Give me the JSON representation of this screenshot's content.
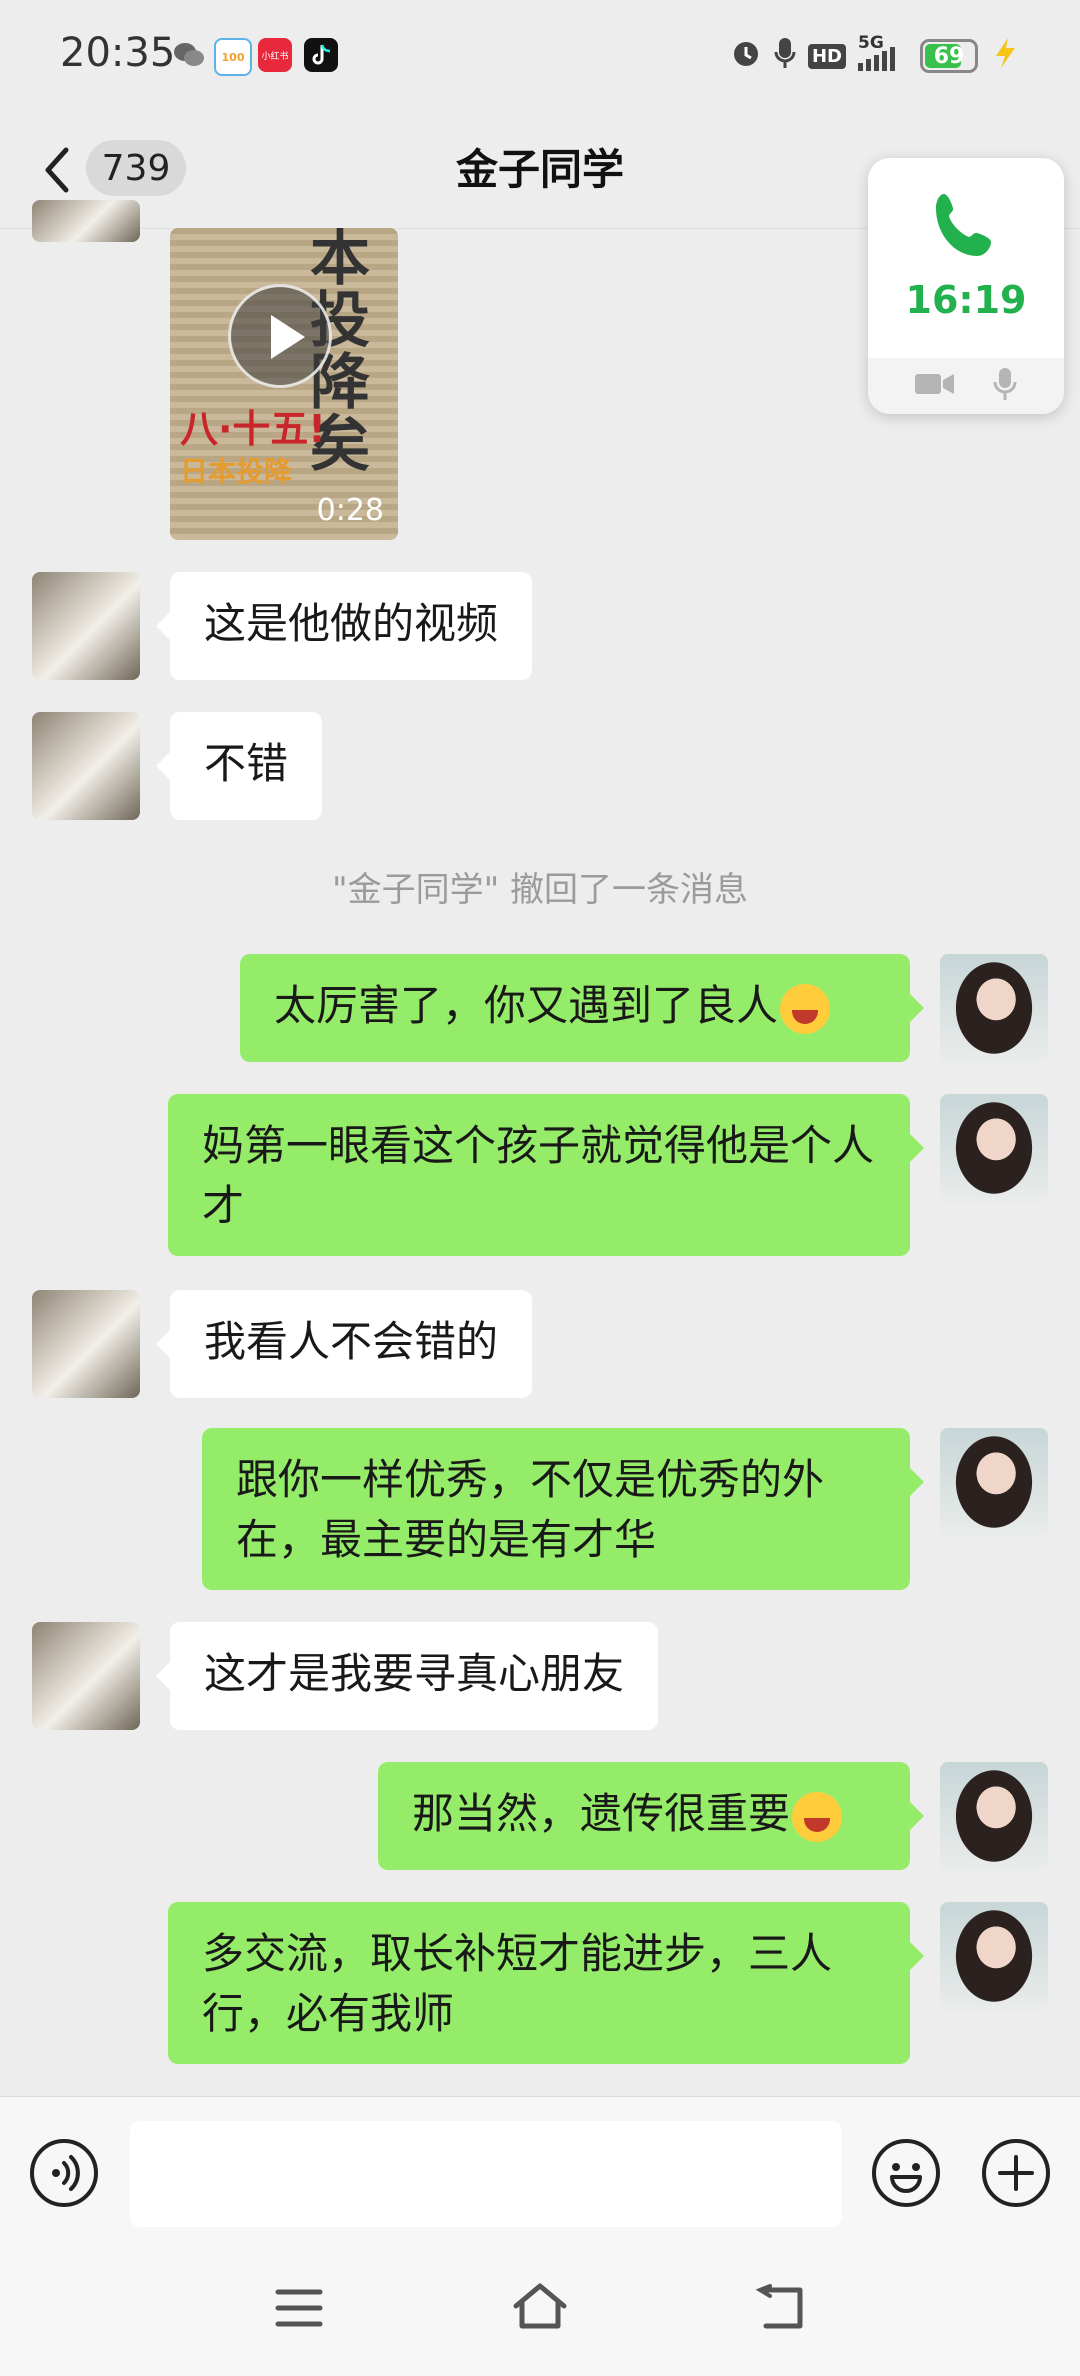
{
  "status_bar": {
    "time": "20:35",
    "app_icons": [
      "wechat-icon",
      "app-100-icon",
      "xiaohongshu-icon",
      "tiktok-icon"
    ],
    "app_labels": [
      "100",
      "小红书"
    ],
    "right_icons": [
      "alarm-icon",
      "mic-icon",
      "hd-icon",
      "5g-signal-icon"
    ],
    "hd_label": "HD",
    "network_label": "5G",
    "battery": "69",
    "charging": true
  },
  "header": {
    "unread_count": "739",
    "title": "金子同学"
  },
  "call_window": {
    "duration": "16:19",
    "accent": "#23b14d"
  },
  "video": {
    "duration": "0:28",
    "caption_red": "八·十五!",
    "caption_orange": "日本投降",
    "headline": "本投降矣"
  },
  "messages": [
    {
      "side": "in",
      "text": "这是他做的视频"
    },
    {
      "side": "in",
      "text": "不错"
    },
    {
      "side": "out",
      "text": "太厉害了，你又遇到了良人",
      "emoji": "laugh-cry-emoji"
    },
    {
      "side": "out",
      "text": "妈第一眼看这个孩子就觉得他是个人才"
    },
    {
      "side": "in",
      "text": "我看人不会错的"
    },
    {
      "side": "out",
      "text": "跟你一样优秀，不仅是优秀的外在，最主要的是有才华"
    },
    {
      "side": "in",
      "text": "这才是我要寻真心朋友"
    },
    {
      "side": "out",
      "text": "那当然，遗传很重要",
      "emoji": "grin-emoji"
    },
    {
      "side": "out",
      "text": "多交流，取长补短才能进步，三人行，必有我师"
    }
  ],
  "system_message": "\"金子同学\" 撤回了一条消息",
  "colors": {
    "outgoing_bubble": "#95ec69",
    "incoming_bubble": "#ffffff",
    "background": "#ededed"
  }
}
